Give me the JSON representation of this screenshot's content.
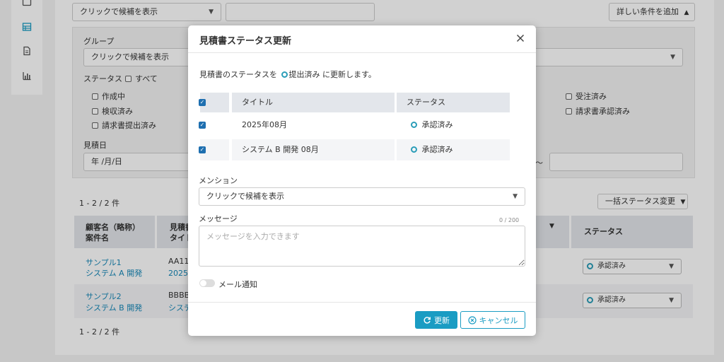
{
  "bg": {
    "top_select": "クリックで候補を表示",
    "add_condition": "詳しい条件を追加",
    "group_label": "グループ",
    "group_select": "クリックで候補を表示",
    "status_label": "ステータス",
    "status_all": "すべて",
    "status_options": [
      "作成中",
      "検収済み",
      "請求書提出済み",
      "受注済み",
      "請求書承認済み"
    ],
    "date_label": "見積日",
    "date_placeholder": "年 /月/日",
    "date_separator": "〜",
    "count_top": "1 - 2 / 2 件",
    "count_bottom": "1 - 2 / 2 件",
    "bulk_button": "一括ステータス変更",
    "columns": {
      "customer": "顧客名（略称）",
      "project": "案件名",
      "estimate_no": "見積書",
      "estimate_title": "タイトル",
      "status": "ステータス"
    },
    "rows": [
      {
        "customer": "サンプル1",
        "project": "システム A 開発",
        "no": "AA112",
        "title": "2025年",
        "status": "承認済み"
      },
      {
        "customer": "サンプル2",
        "project": "システム B 開発",
        "no": "BBBBB",
        "title": "システ",
        "status": "承認済み"
      }
    ]
  },
  "modal": {
    "title": "見積書ステータス更新",
    "desc_prefix": "見積書のステータスを",
    "desc_status": "提出済み",
    "desc_suffix": "に更新します。",
    "table": {
      "col_title": "タイトル",
      "col_status": "ステータス",
      "rows": [
        {
          "title": "2025年08月",
          "status": "承認済み"
        },
        {
          "title": "システム B 開発 08月",
          "status": "承認済み"
        }
      ]
    },
    "mention_label": "メンション",
    "mention_select": "クリックで候補を表示",
    "message_label": "メッセージ",
    "message_counter": "0 / 200",
    "message_placeholder": "メッセージを入力できます",
    "mail_notify": "メール通知",
    "update_button": "更新",
    "cancel_button": "キャンセル"
  },
  "colors": {
    "accent": "#1a9cc3",
    "link": "#1788b8",
    "checkbox": "#1e6fb0",
    "status_ring": "#2a9db8"
  },
  "icons": [
    "grid-icon",
    "document-icon",
    "chart-icon",
    "close-icon",
    "refresh-icon",
    "cancel-circle-icon",
    "chevron-down-icon",
    "chevron-up-icon",
    "sort-down-icon"
  ]
}
